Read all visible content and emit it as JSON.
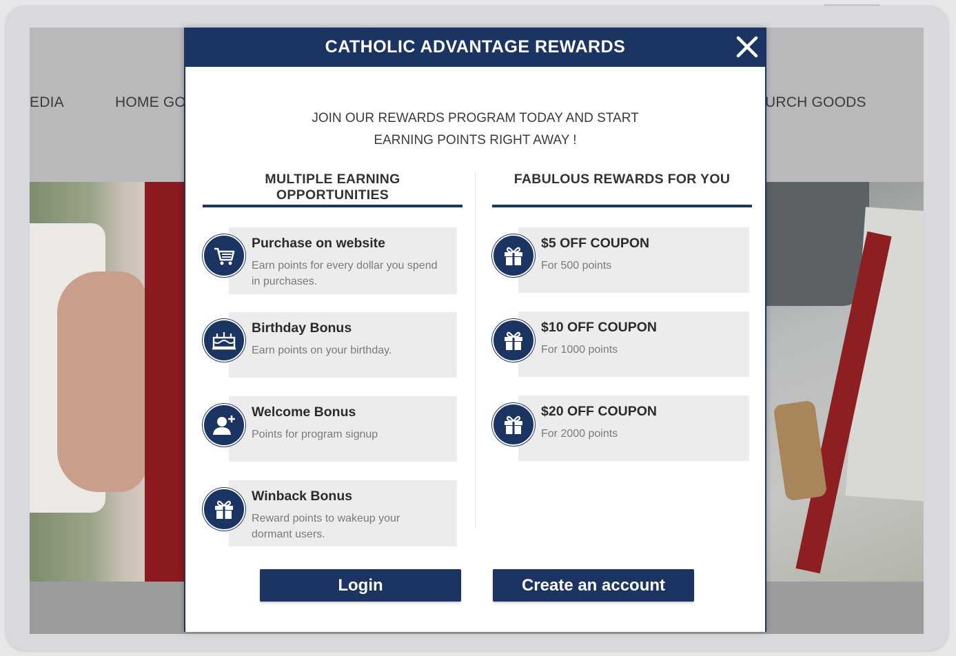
{
  "background_site": {
    "nav_items": [
      "EDIA",
      "HOME GO",
      "URCH GOODS"
    ]
  },
  "modal": {
    "title": "CATHOLIC ADVANTAGE REWARDS",
    "intro_line1": "JOIN OUR REWARDS PROGRAM TODAY AND START",
    "intro_line2": "EARNING POINTS RIGHT AWAY !",
    "left_column": {
      "title_line1": "MULTIPLE EARNING",
      "title_line2": "OPPORTUNITIES",
      "items": [
        {
          "icon": "cart-icon",
          "title": "Purchase on website",
          "desc": "Earn points for every dollar you spend in purchases."
        },
        {
          "icon": "cake-icon",
          "title": "Birthday Bonus",
          "desc": "Earn points on your birthday."
        },
        {
          "icon": "user-add-icon",
          "title": "Welcome Bonus",
          "desc": "Points for program signup"
        },
        {
          "icon": "gift-icon",
          "title": "Winback Bonus",
          "desc": "Reward points to wakeup your dormant users."
        }
      ]
    },
    "right_column": {
      "title": "FABULOUS REWARDS FOR YOU",
      "items": [
        {
          "icon": "gift-icon",
          "title": "$5 OFF COUPON",
          "desc": "For 500 points"
        },
        {
          "icon": "gift-icon",
          "title": "$10 OFF COUPON",
          "desc": "For 1000 points"
        },
        {
          "icon": "gift-icon",
          "title": "$20 OFF COUPON",
          "desc": "For 2000 points"
        }
      ]
    },
    "buttons": {
      "login": "Login",
      "create_account": "Create an account"
    }
  },
  "colors": {
    "primary": "#1b3462",
    "tile_background": "#ececec",
    "header_text": "#ffffff"
  }
}
